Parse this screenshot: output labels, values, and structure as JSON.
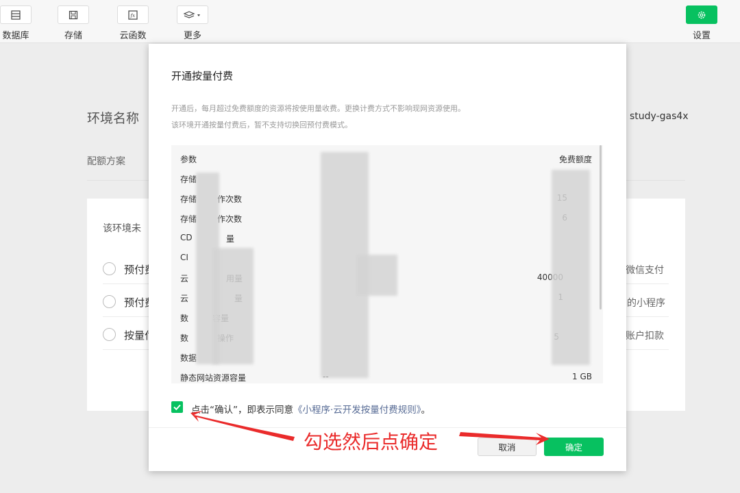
{
  "toolbar": {
    "items": [
      {
        "label": "数据库",
        "icon": "database-icon"
      },
      {
        "label": "存储",
        "icon": "storage-icon"
      },
      {
        "label": "云函数",
        "icon": "cloud-function-icon"
      },
      {
        "label": "更多",
        "icon": "layers-icon"
      }
    ],
    "settings": {
      "label": "设置",
      "icon": "gear-icon"
    }
  },
  "background": {
    "env_label": "环境名称",
    "env_value": "study-gas4x",
    "quota_label": "配额方案",
    "not_open_text": "该环境未",
    "options": [
      {
        "label": "预付费",
        "right": "微信支付"
      },
      {
        "label": "预付费",
        "right": "的小程序"
      },
      {
        "label": "按量付",
        "right": "账户扣款"
      }
    ]
  },
  "modal": {
    "title": "开通按量付费",
    "desc_line1": "开通后，每月超过免费额度的资源将按使用量收费。更换计费方式不影响现网资源使用。",
    "desc_line2": "该环境开通按量付费后，暂不支持切换回预付费模式。",
    "table": {
      "head": {
        "param": "参数",
        "free": "免费额度"
      },
      "rows": [
        {
          "param": "存储",
          "mid": "",
          "free": ""
        },
        {
          "param": "存储",
          "mid": "作次数",
          "free": "15"
        },
        {
          "param": "存储",
          "mid": "作次数",
          "free": "6"
        },
        {
          "param": "CD",
          "mid": "量",
          "free": ""
        },
        {
          "param": "CI",
          "mid": "",
          "free": ""
        },
        {
          "param": "云",
          "mid": "用量",
          "free": "40000"
        },
        {
          "param": "云",
          "mid": "量",
          "free": "1"
        },
        {
          "param": "数",
          "mid": "容量",
          "free": ""
        },
        {
          "param": "数",
          "mid": "操作",
          "free": "5"
        },
        {
          "param": "数据",
          "mid": "",
          "free": ""
        },
        {
          "param": "静态网站资源容量",
          "mid": "--",
          "free": "1 GB"
        }
      ]
    },
    "agree_text": "点击“确认”，即表示同意",
    "agree_link": "《小程序·云开发按量付费规则》",
    "agree_suffix": "。",
    "cancel_label": "取消",
    "ok_label": "确定"
  },
  "annotation": {
    "text": "勾选然后点确定",
    "color": "#ea2b2b"
  },
  "colors": {
    "accent": "#07c160",
    "link": "#576b95"
  }
}
